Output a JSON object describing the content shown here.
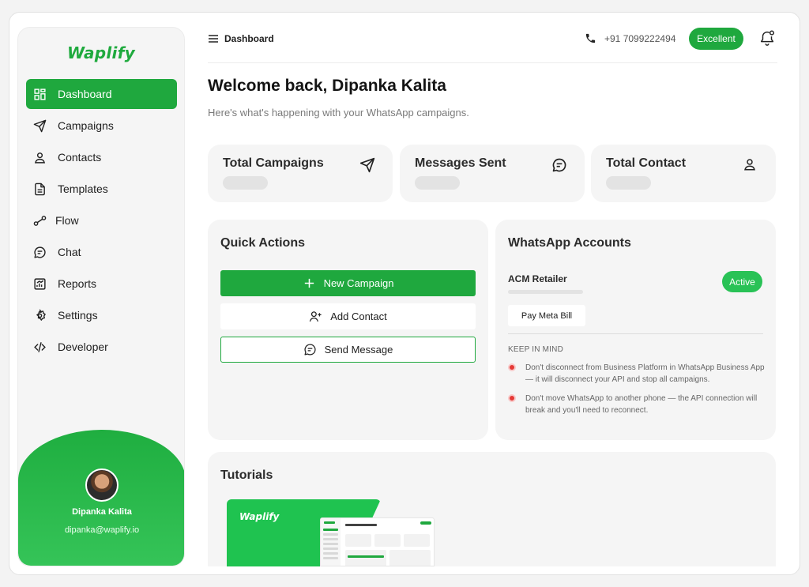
{
  "brand": {
    "name": "Waplify",
    "accent": "#1fa83e"
  },
  "sidebar": {
    "items": [
      {
        "label": "Dashboard",
        "icon": "grid-icon"
      },
      {
        "label": "Campaigns",
        "icon": "send-icon"
      },
      {
        "label": "Contacts",
        "icon": "user-icon"
      },
      {
        "label": "Templates",
        "icon": "document-icon"
      },
      {
        "label": "Flow",
        "icon": "flow-icon"
      },
      {
        "label": "Chat",
        "icon": "chat-icon"
      },
      {
        "label": "Reports",
        "icon": "reports-icon"
      },
      {
        "label": "Settings",
        "icon": "gear-icon"
      },
      {
        "label": "Developer",
        "icon": "code-icon"
      }
    ],
    "active": "Dashboard",
    "profile": {
      "name": "Dipanka Kalita",
      "email": "dipanka@waplify.io"
    }
  },
  "topbar": {
    "breadcrumb": "Dashboard",
    "phone": "+91 7099222494",
    "quality_badge": "Excellent"
  },
  "main": {
    "welcome": "Welcome back, Dipanka Kalita",
    "subtitle": "Here's what's happening with your WhatsApp campaigns.",
    "stats": [
      {
        "label": "Total Campaigns",
        "icon": "send-icon"
      },
      {
        "label": "Messages Sent",
        "icon": "chat-icon"
      },
      {
        "label": "Total Contact",
        "icon": "user-icon"
      }
    ]
  },
  "quick_actions": {
    "title": "Quick Actions",
    "new_campaign": "New Campaign",
    "add_contact": "Add Contact",
    "send_message": "Send Message"
  },
  "whatsapp_accounts": {
    "title": "WhatsApp Accounts",
    "account_name": "ACM Retailer",
    "status": "Active",
    "pay_button": "Pay Meta Bill",
    "keep_in_mind": "KEEP IN MIND",
    "tips": [
      "Don't disconnect from Business Platform in WhatsApp Business App — it will disconnect your API and stop all campaigns.",
      "Don't move WhatsApp to another phone — the API connection will break and you'll need to reconnect."
    ]
  },
  "tutorials": {
    "title": "Tutorials",
    "thumbnail_brand": "Waplify"
  }
}
